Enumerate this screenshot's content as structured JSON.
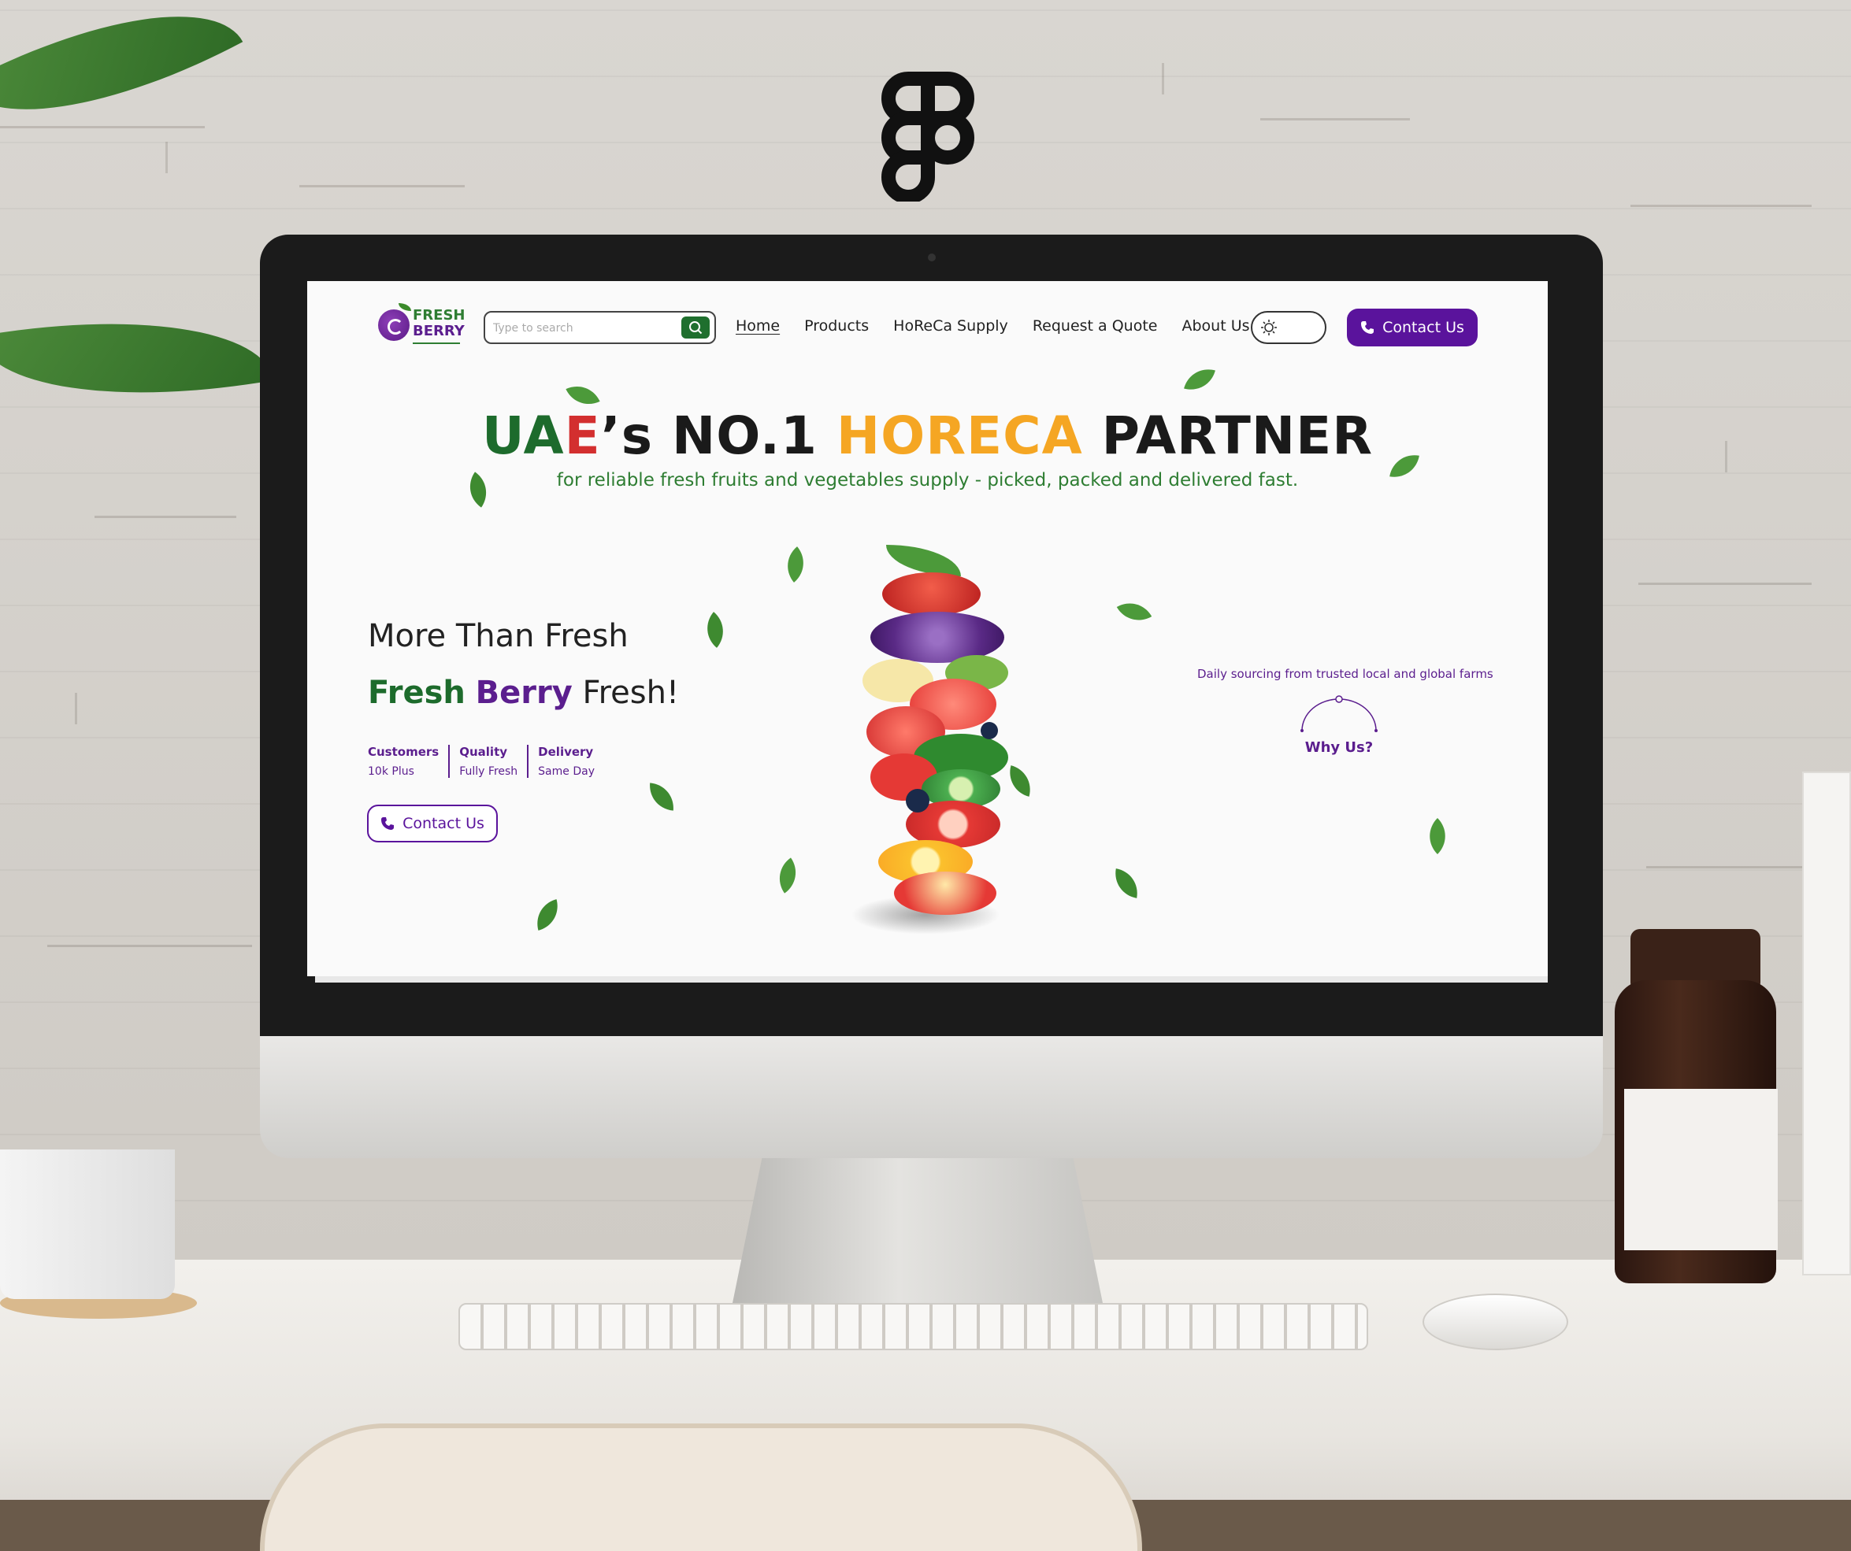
{
  "brand": {
    "fresh": "FRESH",
    "berry": "BERRY"
  },
  "search": {
    "placeholder": "Type to search"
  },
  "nav": {
    "links": [
      "Home",
      "Products",
      "HoReCa Supply",
      "Request a Quote",
      "About Us"
    ],
    "active_index": 0,
    "contact_label": "Contact Us"
  },
  "hero": {
    "title_u": "U",
    "title_a": "A",
    "title_e": "E",
    "title_s": "’s NO.1 ",
    "title_horeca": "HORECA",
    "title_partner": " PARTNER",
    "subtitle": "for reliable fresh fruits and vegetables supply - picked, packed and delivered fast.",
    "line1": "More Than Fresh",
    "line2_fresh": "Fresh",
    "line2_berry": "Berry",
    "line2_end": "Fresh!",
    "contact_label": "Contact Us"
  },
  "stats": [
    {
      "label": "Customers",
      "value": "10k Plus"
    },
    {
      "label": "Quality",
      "value": "Fully Fresh"
    },
    {
      "label": "Delivery",
      "value": "Same Day"
    }
  ],
  "side": {
    "daily": "Daily sourcing from trusted local and global farms",
    "why": "Why Us?"
  },
  "colors": {
    "brand_green": "#1d6b2c",
    "brand_purple": "#5a139c",
    "accent_orange": "#f5a623",
    "accent_red": "#d32f2f"
  },
  "icons": {
    "search": "search-icon",
    "theme": "sun-icon",
    "phone": "phone-icon",
    "app": "figma-logo"
  }
}
